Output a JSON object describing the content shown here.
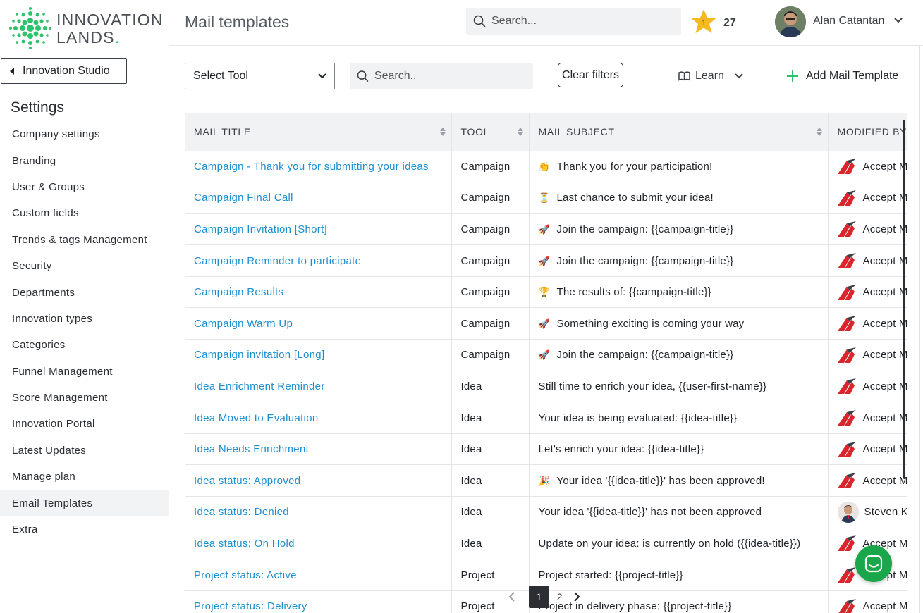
{
  "brand": {
    "line1": "INNOVATION",
    "line2": "LANDS",
    "dot": ".",
    "accent": "#2cc36b"
  },
  "sidebar": {
    "back_label": "Innovation Studio",
    "section_title": "Settings",
    "items": [
      {
        "label": "Company settings"
      },
      {
        "label": "Branding"
      },
      {
        "label": "User & Groups"
      },
      {
        "label": "Custom fields"
      },
      {
        "label": "Trends & tags Management"
      },
      {
        "label": "Security"
      },
      {
        "label": "Departments"
      },
      {
        "label": "Innovation types"
      },
      {
        "label": "Categories"
      },
      {
        "label": "Funnel Management"
      },
      {
        "label": "Score Management"
      },
      {
        "label": "Innovation Portal"
      },
      {
        "label": "Latest Updates"
      },
      {
        "label": "Manage plan"
      },
      {
        "label": "Email Templates",
        "active": true
      },
      {
        "label": "Extra"
      }
    ]
  },
  "header": {
    "title": "Mail templates",
    "search_placeholder": "Search...",
    "star_level": "1",
    "points": "27",
    "user_name": "Alan Catantan"
  },
  "toolbar": {
    "select_tool": "Select Tool",
    "search_placeholder": "Search..",
    "clear_filters": "Clear filters",
    "learn": "Learn",
    "add_label": "Add Mail Template"
  },
  "table": {
    "columns": [
      "MAIL TITLE",
      "TOOL",
      "MAIL SUBJECT",
      "MODIFIED BY"
    ],
    "rows": [
      {
        "title": "Campaign - Thank you for submitting your ideas",
        "tool": "Campaign",
        "emoji": "👏",
        "subject": "Thank you for your participation!",
        "modified": "Accept Mission",
        "avatar": "logo"
      },
      {
        "title": "Campaign Final Call",
        "tool": "Campaign",
        "emoji": "⏳",
        "subject": "Last chance to submit your idea!",
        "modified": "Accept Mission",
        "avatar": "logo"
      },
      {
        "title": "Campaign Invitation [Short]",
        "tool": "Campaign",
        "emoji": "🚀",
        "subject": "Join the campaign: {{campaign-title}}",
        "modified": "Accept Mission",
        "avatar": "logo"
      },
      {
        "title": "Campaign Reminder to participate",
        "tool": "Campaign",
        "emoji": "🚀",
        "subject": "Join the campaign: {{campaign-title}}",
        "modified": "Accept Mission",
        "avatar": "logo"
      },
      {
        "title": "Campaign Results",
        "tool": "Campaign",
        "emoji": "🏆",
        "subject": "The results of: {{campaign-title}}",
        "modified": "Accept Mission",
        "avatar": "logo"
      },
      {
        "title": "Campaign Warm Up",
        "tool": "Campaign",
        "emoji": "🚀",
        "subject": "Something exciting is coming your way",
        "modified": "Accept Mission",
        "avatar": "logo"
      },
      {
        "title": "Campaign invitation [Long]",
        "tool": "Campaign",
        "emoji": "🚀",
        "subject": "Join the campaign: {{campaign-title}}",
        "modified": "Accept Mission",
        "avatar": "logo"
      },
      {
        "title": "Idea Enrichment Reminder",
        "tool": "Idea",
        "emoji": "",
        "subject": "Still time to enrich your idea, {{user-first-name}}",
        "modified": "Accept Mission",
        "avatar": "logo"
      },
      {
        "title": "Idea Moved to Evaluation",
        "tool": "Idea",
        "emoji": "",
        "subject": "Your idea is being evaluated: {{idea-title}}",
        "modified": "Accept Mission",
        "avatar": "logo"
      },
      {
        "title": "Idea Needs Enrichment",
        "tool": "Idea",
        "emoji": "",
        "subject": "Let's enrich your idea: {{idea-title}}",
        "modified": "Accept Mission",
        "avatar": "logo"
      },
      {
        "title": "Idea status: Approved",
        "tool": "Idea",
        "emoji": "🎉",
        "subject": "Your idea '{{idea-title}}' has been approved!",
        "modified": "Accept Mission",
        "avatar": "logo"
      },
      {
        "title": "Idea status: Denied",
        "tool": "Idea",
        "emoji": "",
        "subject": "Your idea '{{idea-title}}' has not been approved",
        "modified": "Steven Kok",
        "avatar": "person"
      },
      {
        "title": "Idea status: On Hold",
        "tool": "Idea",
        "emoji": "",
        "subject": "Update on your idea: is currently on hold ({{idea-title}})",
        "modified": "Accept Mission",
        "avatar": "logo"
      },
      {
        "title": "Project status: Active",
        "tool": "Project",
        "emoji": "",
        "subject": "Project started: {{project-title}}",
        "modified": "Accept Mission",
        "avatar": "logo"
      },
      {
        "title": "Project status: Delivery",
        "tool": "Project",
        "emoji": "",
        "subject": "Project in delivery phase: {{project-title}}",
        "modified": "Accept Mission",
        "avatar": "logo"
      }
    ]
  },
  "pagination": {
    "pages": [
      "1",
      "2"
    ],
    "current": "1"
  }
}
